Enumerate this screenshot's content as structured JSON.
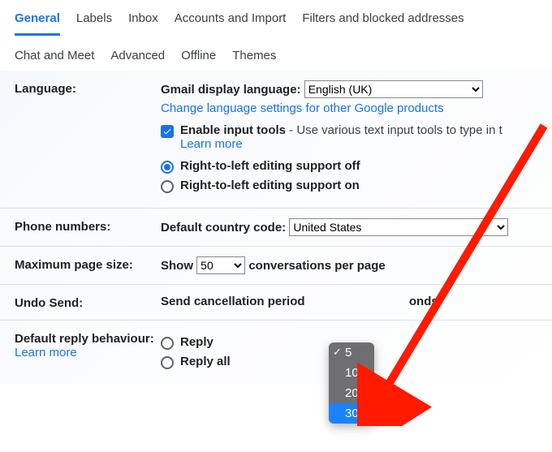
{
  "tabs_row1": [
    "General",
    "Labels",
    "Inbox",
    "Accounts and Import",
    "Filters and blocked addresses"
  ],
  "tabs_row2": [
    "Chat and Meet",
    "Advanced",
    "Offline",
    "Themes"
  ],
  "active_tab_index": 0,
  "language": {
    "label": "Language:",
    "display_label": "Gmail display language:",
    "selected": "English (UK)",
    "change_link": "Change language settings for other Google products",
    "input_tools_label": "Enable input tools",
    "input_tools_desc": " - Use various text input tools to type in t",
    "learn_more": "Learn more",
    "rtl_off": "Right-to-left editing support off",
    "rtl_on": "Right-to-left editing support on"
  },
  "phone": {
    "label": "Phone numbers:",
    "code_label": "Default country code:",
    "selected": "United States"
  },
  "pagesize": {
    "label": "Maximum page size:",
    "show": "Show",
    "selected": "50",
    "suffix": "conversations per page"
  },
  "undo": {
    "label": "Undo Send:",
    "text_before": "Send cancellation period",
    "text_after": "onds",
    "options": [
      "5",
      "10",
      "20",
      "30"
    ],
    "current_check": "5",
    "highlighted": "30"
  },
  "reply": {
    "label": "Default reply behaviour:",
    "learn_more": "Learn more",
    "opt1": "Reply",
    "opt2": "Reply all"
  }
}
